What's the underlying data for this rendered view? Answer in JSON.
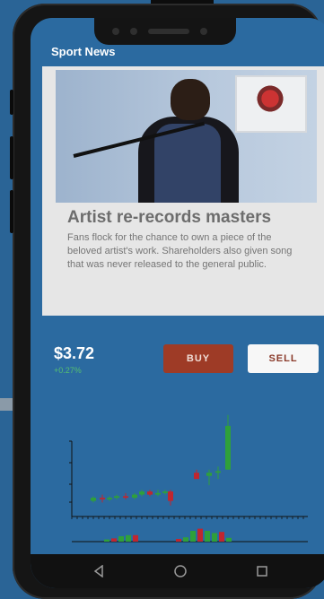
{
  "app": {
    "title": "Sport News"
  },
  "news": {
    "headline": "Artist re-records masters",
    "body": "Fans flock for the chance to own a piece of the beloved artist's work. Shareholders also given song that was never released to the general public."
  },
  "trade": {
    "price": "$3.72",
    "change": "+0.27%",
    "buy_label": "BUY",
    "sell_label": "SELL"
  },
  "colors": {
    "background": "#2a6496",
    "screen": "#2b6aa0",
    "buy": "#9e3b26",
    "sell": "#f7f7f7",
    "up": "#2fa03a",
    "down": "#c0262f"
  },
  "chart_data": {
    "type": "candlestick",
    "candles": [
      {
        "open": 3.2,
        "close": 3.22,
        "high": 3.23,
        "low": 3.19
      },
      {
        "open": 3.22,
        "close": 3.21,
        "high": 3.24,
        "low": 3.19
      },
      {
        "open": 3.21,
        "close": 3.22,
        "high": 3.23,
        "low": 3.2
      },
      {
        "open": 3.22,
        "close": 3.23,
        "high": 3.24,
        "low": 3.21
      },
      {
        "open": 3.23,
        "close": 3.22,
        "high": 3.25,
        "low": 3.21
      },
      {
        "open": 3.22,
        "close": 3.24,
        "high": 3.25,
        "low": 3.21
      },
      {
        "open": 3.24,
        "close": 3.26,
        "high": 3.27,
        "low": 3.23
      },
      {
        "open": 3.26,
        "close": 3.24,
        "high": 3.27,
        "low": 3.23
      },
      {
        "open": 3.24,
        "close": 3.25,
        "high": 3.27,
        "low": 3.23
      },
      {
        "open": 3.25,
        "close": 3.26,
        "high": 3.27,
        "low": 3.24
      },
      {
        "open": 3.26,
        "close": 3.2,
        "high": 3.27,
        "low": 3.17
      },
      {
        "open": 3.38,
        "close": 3.34,
        "high": 3.4,
        "low": 3.34
      },
      {
        "open": 3.36,
        "close": 3.38,
        "high": 3.4,
        "low": 3.3
      },
      {
        "open": 3.38,
        "close": 3.39,
        "high": 3.42,
        "low": 3.34
      },
      {
        "open": 3.4,
        "close": 3.68,
        "high": 3.75,
        "low": 3.4
      }
    ],
    "volume": [
      0.4,
      0.6,
      1.0,
      1.2,
      1.2,
      0,
      0,
      0.5,
      0.8,
      2.0,
      2.4,
      2.0,
      1.6,
      1.8,
      0.7
    ]
  }
}
